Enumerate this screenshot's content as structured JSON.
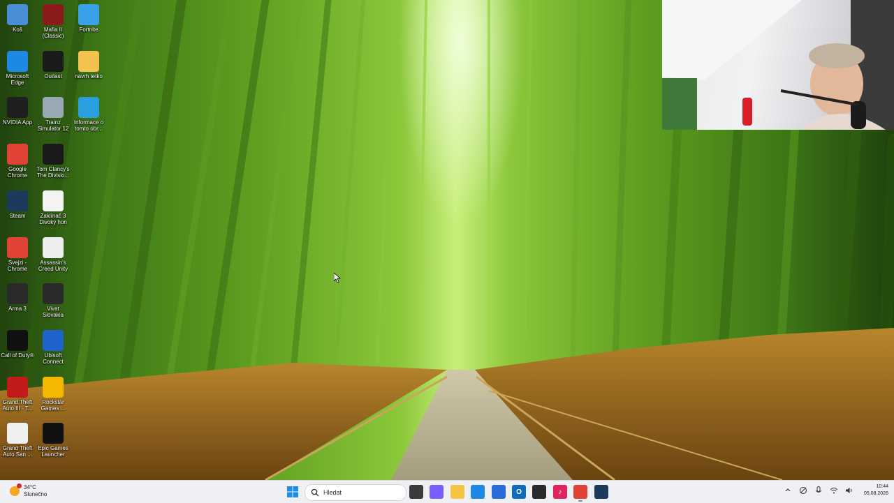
{
  "desktop_icons": [
    {
      "label": "Koš",
      "icon": "recycle-bin-icon",
      "color": "#4a8fd6"
    },
    {
      "label": "Mafia II (Classic)",
      "icon": "mafia-icon",
      "color": "#8c1c1c"
    },
    {
      "label": "Fortnite",
      "icon": "fortnite-icon",
      "color": "#3aa0e8"
    },
    {
      "label": "Microsoft Edge",
      "icon": "edge-icon",
      "color": "#1e88e5"
    },
    {
      "label": "Outlast",
      "icon": "outlast-icon",
      "color": "#1b1b1b"
    },
    {
      "label": "navrh tetko",
      "icon": "folder-icon",
      "color": "#f2c14e"
    },
    {
      "label": "NVIDIA App",
      "icon": "nvidia-icon",
      "color": "#1f1f1f"
    },
    {
      "label": "Trainz Simulator 12",
      "icon": "trainz-icon",
      "color": "#9aa8b5"
    },
    {
      "label": "Informace o tomto obr...",
      "icon": "info-icon",
      "color": "#2a9fe0"
    },
    {
      "label": "Google Chrome",
      "icon": "chrome-icon",
      "color": "#e04336"
    },
    {
      "label": "Tom Clancy's The Divisio...",
      "icon": "division-icon",
      "color": "#1a1a1a"
    },
    {
      "label": "Steam",
      "icon": "steam-icon",
      "color": "#1b3a5c"
    },
    {
      "label": "Zaklínač 3 Divoký hon",
      "icon": "witcher-icon",
      "color": "#f3f3f3"
    },
    {
      "label": "Svejzi - Chrome",
      "icon": "chrome-profile-icon",
      "color": "#e04336"
    },
    {
      "label": "Assassin's Creed Unity",
      "icon": "assassins-creed-icon",
      "color": "#eeeeee"
    },
    {
      "label": "Arma 3",
      "icon": "arma-icon",
      "color": "#2a2a2a"
    },
    {
      "label": "Vivat Slovakia",
      "icon": "vivat-icon",
      "color": "#2a2a2a"
    },
    {
      "label": "Call of Duty®",
      "icon": "cod-icon",
      "color": "#111111"
    },
    {
      "label": "Ubisoft Connect",
      "icon": "ubisoft-icon",
      "color": "#1e63c9"
    },
    {
      "label": "Grand Theft Auto III - T...",
      "icon": "gta3-icon",
      "color": "#c21b1b"
    },
    {
      "label": "Rockstar Games ...",
      "icon": "rockstar-icon",
      "color": "#f5b800"
    },
    {
      "label": "Grand Theft Auto San ...",
      "icon": "gta-sa-icon",
      "color": "#f0f0f0"
    },
    {
      "label": "Epic Games Launcher",
      "icon": "epic-games-icon",
      "color": "#111111"
    }
  ],
  "taskbar": {
    "weather": {
      "temp": "34°C",
      "condition": "Slunečno"
    },
    "search_placeholder": "Hledat",
    "pinned": [
      {
        "name": "task-view",
        "color": "#3a3a3a",
        "glyph": ""
      },
      {
        "name": "copilot",
        "color": "#7b5cff",
        "glyph": ""
      },
      {
        "name": "file-explorer",
        "color": "#f4c542",
        "glyph": ""
      },
      {
        "name": "edge",
        "color": "#1e88e5",
        "glyph": ""
      },
      {
        "name": "store",
        "color": "#2b6bd9",
        "glyph": ""
      },
      {
        "name": "outlook",
        "color": "#0f6cbd",
        "glyph": "O"
      },
      {
        "name": "obs",
        "color": "#2a2a2a",
        "glyph": ""
      },
      {
        "name": "tiktok",
        "color": "#e0245e",
        "glyph": "♪"
      },
      {
        "name": "chrome",
        "color": "#e04336",
        "glyph": ""
      },
      {
        "name": "steam",
        "color": "#1b3a5c",
        "glyph": ""
      }
    ],
    "clock": {
      "time": "10:44",
      "date": "05.08.2026"
    }
  }
}
